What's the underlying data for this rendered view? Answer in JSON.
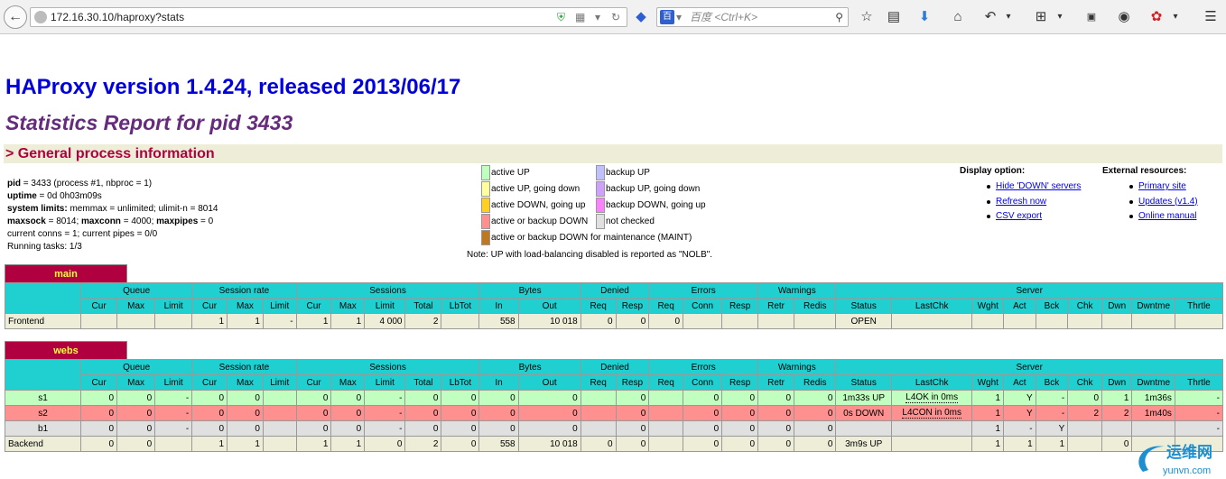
{
  "browser": {
    "url": "172.16.30.10/haproxy?stats",
    "search_engine": "百",
    "search_placeholder": "百度 <Ctrl+K>"
  },
  "page": {
    "title": "HAProxy version 1.4.24, released 2013/06/17",
    "subtitle": "Statistics Report for pid 3433",
    "section": "> General process information"
  },
  "info": {
    "pid_label": "pid",
    "pid_value": " = 3433 (process #1, nbproc = 1)",
    "uptime_label": "uptime",
    "uptime_value": " = 0d 0h03m09s",
    "syslim_label": "system limits:",
    "syslim_value": " memmax = unlimited; ulimit-n = 8014",
    "maxsock_label": "maxsock",
    "maxsock_value": " = 8014; ",
    "maxconn_label": "maxconn",
    "maxconn_value": " = 4000; ",
    "maxpipes_label": "maxpipes",
    "maxpipes_value": " = 0",
    "conns": "current conns = 1; current pipes = 0/0",
    "tasks": "Running tasks: 1/3"
  },
  "legend": [
    {
      "label": "active UP",
      "color": "#c0ffc0"
    },
    {
      "label": "active UP, going down",
      "color": "#ffffa0"
    },
    {
      "label": "active DOWN, going up",
      "color": "#ffd020"
    },
    {
      "label": "active or backup DOWN",
      "color": "#ff9090"
    },
    {
      "label": "active or backup DOWN for maintenance (MAINT)",
      "color": "#c07820"
    },
    {
      "label": "backup UP",
      "color": "#c0c0ff"
    },
    {
      "label": "backup UP, going down",
      "color": "#d0a0ff"
    },
    {
      "label": "backup DOWN, going up",
      "color": "#ff80ff"
    },
    {
      "label": "not checked",
      "color": "#e0e0e0"
    }
  ],
  "note": "Note: UP with load-balancing disabled is reported as \"NOLB\".",
  "display_options": {
    "title": "Display option:",
    "items": [
      "Hide 'DOWN' servers",
      "Refresh now",
      "CSV export"
    ]
  },
  "external_resources": {
    "title": "External resources:",
    "items": [
      "Primary site",
      "Updates (v1.4)",
      "Online manual"
    ]
  },
  "groups": [
    "Queue",
    "Session rate",
    "Sessions",
    "Bytes",
    "Denied",
    "Errors",
    "Warnings",
    "Server"
  ],
  "columns": [
    "Cur",
    "Max",
    "Limit",
    "Cur",
    "Max",
    "Limit",
    "Cur",
    "Max",
    "Limit",
    "Total",
    "LbTot",
    "In",
    "Out",
    "Req",
    "Resp",
    "Req",
    "Conn",
    "Resp",
    "Retr",
    "Redis",
    "Status",
    "LastChk",
    "Wght",
    "Act",
    "Bck",
    "Chk",
    "Dwn",
    "Dwntme",
    "Thrtle"
  ],
  "main": {
    "name": "main",
    "rows": [
      [
        "Frontend",
        "",
        "",
        "",
        "1",
        "1",
        "-",
        "1",
        "1",
        "4 000",
        "2",
        "",
        "558",
        "10 018",
        "0",
        "0",
        "0",
        "",
        "",
        "",
        "",
        "OPEN",
        "",
        "",
        "",
        "",
        "",
        "",
        "",
        ""
      ]
    ]
  },
  "webs": {
    "name": "webs",
    "rows": [
      [
        "s1",
        "0",
        "0",
        "-",
        "0",
        "0",
        "",
        "0",
        "0",
        "-",
        "0",
        "0",
        "0",
        "0",
        "",
        "0",
        "",
        "0",
        "0",
        "0",
        "0",
        "1m33s UP",
        "L4OK in 0ms",
        "1",
        "Y",
        "-",
        "0",
        "1",
        "1m36s",
        "-"
      ],
      [
        "s2",
        "0",
        "0",
        "-",
        "0",
        "0",
        "",
        "0",
        "0",
        "-",
        "0",
        "0",
        "0",
        "0",
        "",
        "0",
        "",
        "0",
        "0",
        "0",
        "0",
        "0s DOWN",
        "L4CON in 0ms",
        "1",
        "Y",
        "-",
        "2",
        "2",
        "1m40s",
        "-"
      ],
      [
        "b1",
        "0",
        "0",
        "-",
        "0",
        "0",
        "",
        "0",
        "0",
        "-",
        "0",
        "0",
        "0",
        "0",
        "",
        "0",
        "",
        "0",
        "0",
        "0",
        "0",
        "",
        "",
        "1",
        "-",
        "Y",
        "",
        "",
        "",
        "-"
      ],
      [
        "Backend",
        "0",
        "0",
        "",
        "1",
        "1",
        "",
        "1",
        "1",
        "0",
        "2",
        "0",
        "558",
        "10 018",
        "0",
        "0",
        "",
        "0",
        "0",
        "0",
        "0",
        "3m9s UP",
        "",
        "1",
        "1",
        "1",
        "",
        "0",
        "",
        ""
      ]
    ]
  },
  "watermark": {
    "brand": "运维网",
    "domain": "yunvn.com"
  }
}
